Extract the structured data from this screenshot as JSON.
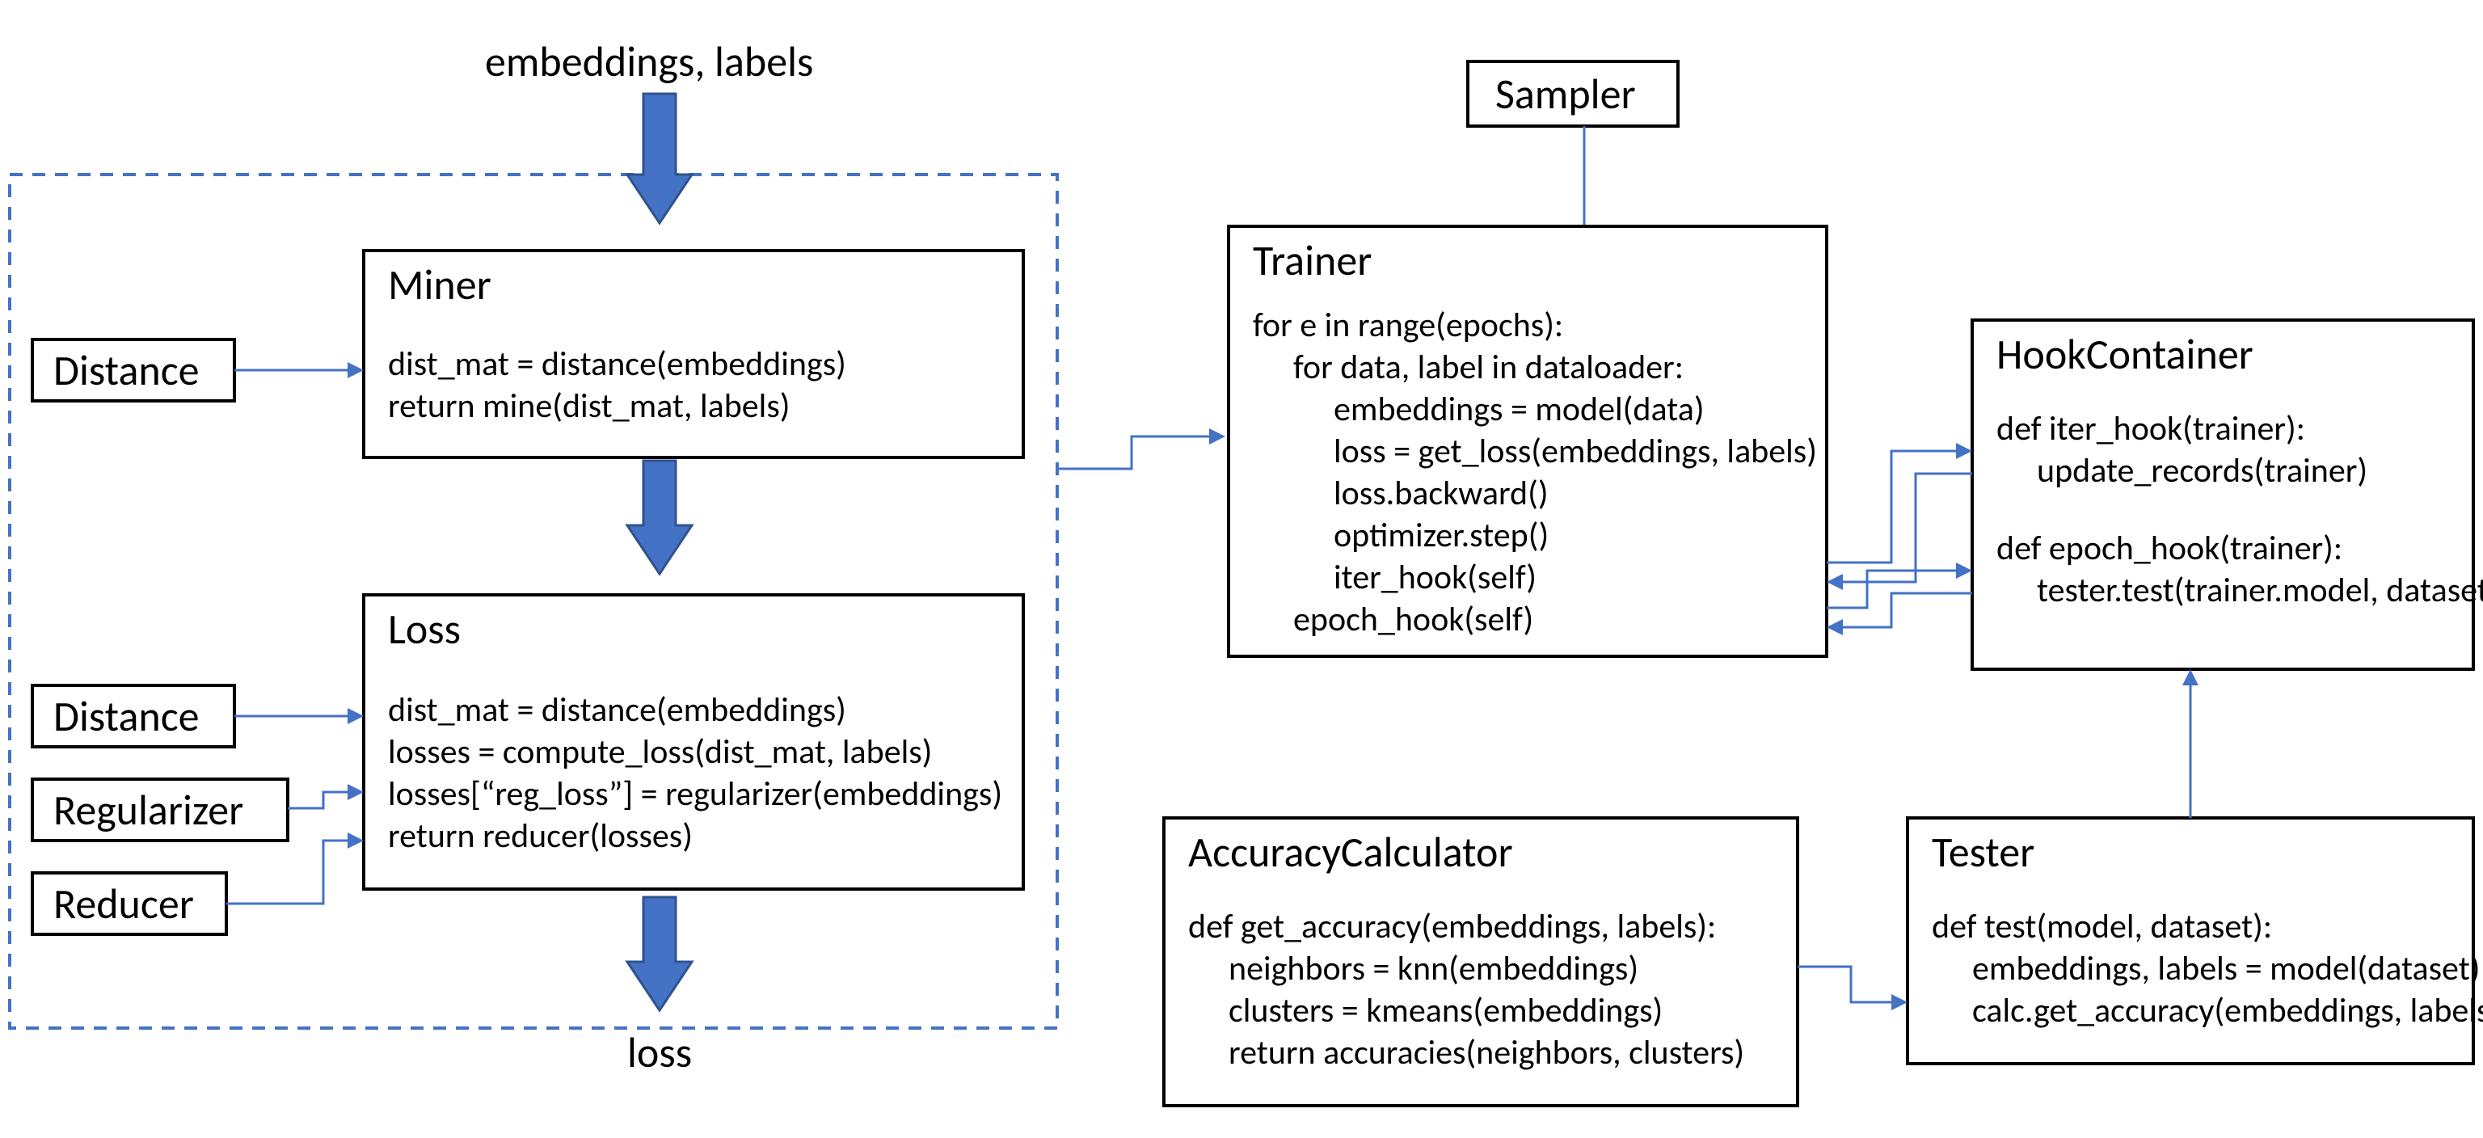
{
  "top_label": "embeddings, labels",
  "bottom_label": "loss",
  "distance1": {
    "title": "Distance"
  },
  "distance2": {
    "title": "Distance"
  },
  "regularizer": {
    "title": "Regularizer"
  },
  "reducer": {
    "title": "Reducer"
  },
  "miner": {
    "title": "Miner",
    "l1": "dist_mat = distance(embeddings)",
    "l2": "return mine(dist_mat, labels)"
  },
  "loss": {
    "title": "Loss",
    "l1": "dist_mat = distance(embeddings)",
    "l2": "losses = compute_loss(dist_mat, labels)",
    "l3": "losses[“reg_loss”] = regularizer(embeddings)",
    "l4": "return reducer(losses)"
  },
  "sampler": {
    "title": "Sampler"
  },
  "trainer": {
    "title": "Trainer",
    "l1": "for e in range(epochs):",
    "l2": "for data, label in dataloader:",
    "l3": "embeddings = model(data)",
    "l4": "loss = get_loss(embeddings, labels)",
    "l5": "loss.backward()",
    "l6": "optimizer.step()",
    "l7": "iter_hook(self)",
    "l8": "epoch_hook(self)"
  },
  "hook": {
    "title": "HookContainer",
    "l1": "def iter_hook(trainer):",
    "l2": "update_records(trainer)",
    "l3": "def epoch_hook(trainer):",
    "l4": "tester.test(trainer.model, dataset)"
  },
  "acc": {
    "title": "AccuracyCalculator",
    "l1": "def get_accuracy(embeddings, labels):",
    "l2": "neighbors = knn(embeddings)",
    "l3": "clusters = kmeans(embeddings)",
    "l4": "return accuracies(neighbors, clusters)"
  },
  "tester": {
    "title": "Tester",
    "l1": "def test(model, dataset):",
    "l2": "embeddings, labels = model(dataset)",
    "l3": "calc.get_accuracy(embeddings, labels)"
  }
}
